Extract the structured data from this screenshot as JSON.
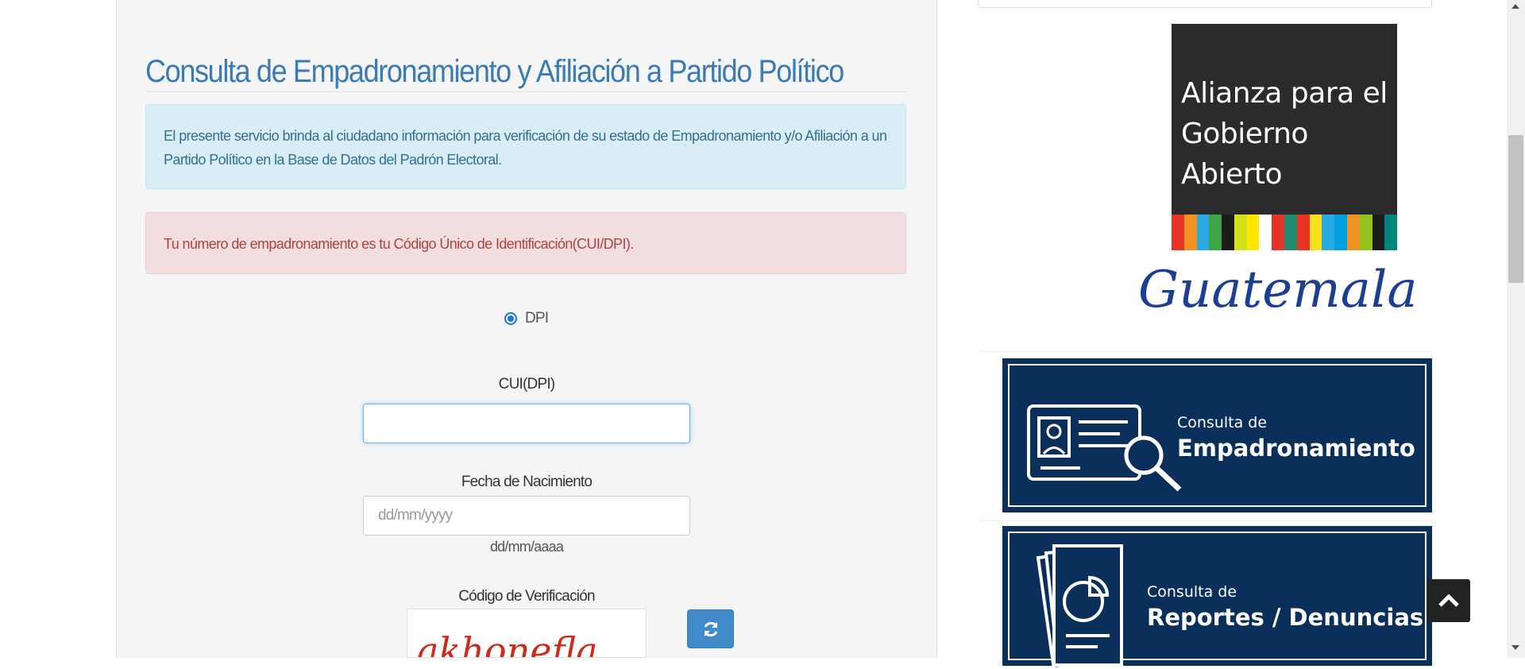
{
  "main": {
    "title": "Consulta de Empadronamiento y Afiliación a Partido Político",
    "info_alert": "El presente servicio brinda al ciudadano información para verificación de su estado de Empadronamiento y/o Afiliación a un Partido Político en la Base de Datos del Padrón Electoral.",
    "danger_alert": "Tu número de empadronamiento es tu Código Único de Identificación(CUI/DPI).",
    "radio": {
      "label": "DPI",
      "checked": true
    },
    "cui": {
      "label": "CUI(DPI)",
      "value": "",
      "placeholder": ""
    },
    "birthdate": {
      "label": "Fecha de Nacimiento",
      "placeholder": "dd/mm/yyyy",
      "hint": "dd/mm/aaaa"
    },
    "captcha": {
      "label": "Código de Verificación",
      "text": "akhonefla",
      "refresh_icon": "refresh-icon"
    }
  },
  "sidebar": {
    "aga_logo": {
      "lines": [
        "Alianza para el",
        "Gobierno",
        "Abierto"
      ],
      "script_text": "Guatemala",
      "stripe_colors": [
        "#e63323",
        "#f29222",
        "#28a9e1",
        "#3ca548",
        "#1d1d1b",
        "#d4e21b",
        "#ffe600",
        "#ffffff",
        "#e6332a",
        "#1f8a70",
        "#e63323",
        "#f7e11e",
        "#28a9e1",
        "#00a0e3",
        "#f29222",
        "#95c11f",
        "#1d1d1b",
        "#00847e"
      ]
    },
    "banner_empadronamiento": {
      "small": "Consulta de",
      "big": "Empadronamiento"
    },
    "banner_reportes": {
      "small": "Consulta de",
      "big": "Reportes / Denuncias"
    },
    "scroll_top_icon": "chevron-up-icon"
  },
  "colors": {
    "title": "#3a7ab5",
    "banner_bg": "#0b2f5b",
    "info_bg": "#d9edf7",
    "danger_bg": "#f2dede",
    "button_primary": "#428bca"
  }
}
